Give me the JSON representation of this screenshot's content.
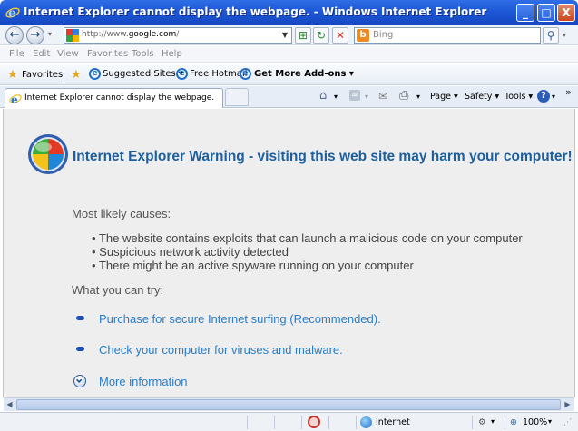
{
  "window": {
    "title": "Internet Explorer cannot display the webpage. - Windows Internet Explorer",
    "controls": {
      "minimize": "_",
      "maximize": "□",
      "close": "X"
    }
  },
  "address_bar": {
    "url_prefix": "http://www.",
    "url_domain": "google.com",
    "url_suffix": "/",
    "search_placeholder": "Bing"
  },
  "menu": [
    "File",
    "Edit",
    "View",
    "Favorites",
    "Tools",
    "Help"
  ],
  "favorites_bar": {
    "favorites_label": "Favorites",
    "items": [
      "Suggested Sites ▾",
      "Free Hotmail",
      "Get More Add-ons ▾"
    ]
  },
  "tab": {
    "title": "Internet Explorer cannot display the webpage."
  },
  "command_bar": {
    "page": "Page ▾",
    "safety": "Safety ▾",
    "tools": "Tools ▾",
    "more": "»"
  },
  "page": {
    "heading": "Internet Explorer Warning - visiting this web site may harm your computer!",
    "causes_title": "Most likely causes:",
    "causes": [
      "The website contains exploits that can launch a malicious code on your computer",
      "Suspicious network activity detected",
      "There might be an active spyware running on your computer"
    ],
    "try_title": "What you can try:",
    "actions": [
      "Purchase for secure Internet surfing (Recommended).",
      "Check your computer for viruses and malware."
    ],
    "more_info": "More information"
  },
  "status_bar": {
    "zone": "Internet",
    "zoom": "100%"
  },
  "icons": [
    "ie-logo-icon",
    "back-icon",
    "forward-icon",
    "refresh-icon",
    "stop-icon",
    "search-icon",
    "star-icon",
    "home-icon",
    "rss-icon",
    "mail-icon",
    "print-icon",
    "help-icon",
    "shield-warning-icon",
    "globe-icon",
    "zoom-icon"
  ],
  "colors": {
    "titlebar": "#1d57d6",
    "heading": "#1d5f9e",
    "link": "#2a7dc9",
    "content_bg": "#eeeeee"
  }
}
